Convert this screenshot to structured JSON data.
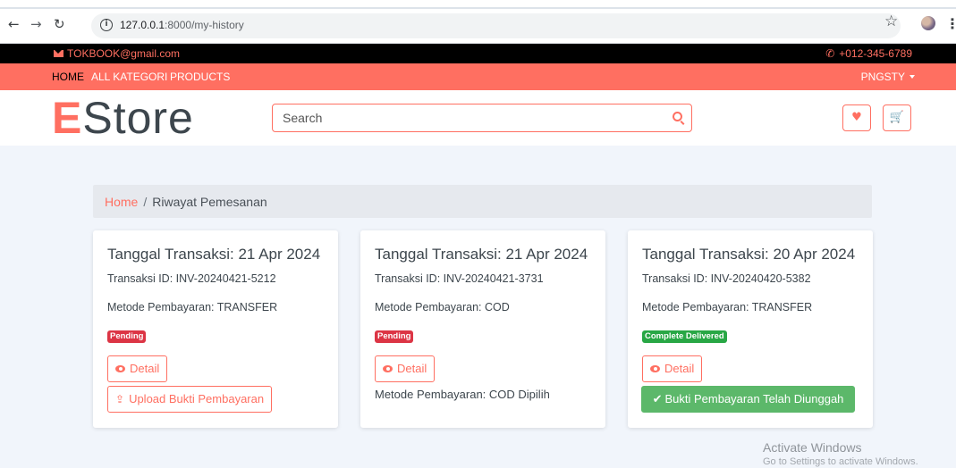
{
  "browser": {
    "back_icon": "arrow-left-icon",
    "forward_icon": "arrow-right-icon",
    "reload_icon": "reload-icon",
    "url_host": "127.0.0.1",
    "url_path": ":8000/my-history"
  },
  "topbar": {
    "email": "TOKBOOK@gmail.com",
    "phone": "+012-345-6789"
  },
  "nav": {
    "items": [
      {
        "label": "HOME",
        "active": true
      },
      {
        "label": "ALL KATEGORI",
        "active": false
      },
      {
        "label": "PRODUCTS",
        "active": false
      }
    ],
    "user": "PNGSTY"
  },
  "header": {
    "logo_first": "E",
    "logo_rest": "Store",
    "search_placeholder": "Search"
  },
  "breadcrumb": {
    "home": "Home",
    "separator": "/",
    "current": "Riwayat Pemesanan"
  },
  "orders": [
    {
      "title": "Tanggal Transaksi: 21 Apr 2024",
      "transaction_id": "Transaksi ID: INV-20240421-5212",
      "payment_method": "Metode Pembayaran: TRANSFER",
      "status": "Pending",
      "detail_label": "Detail",
      "action_label": "Upload Bukti Pembayaran"
    },
    {
      "title": "Tanggal Transaksi: 21 Apr 2024",
      "transaction_id": "Transaksi ID: INV-20240421-3731",
      "payment_method": "Metode Pembayaran: COD",
      "status": "Pending",
      "detail_label": "Detail",
      "note": "Metode Pembayaran: COD Dipilih"
    },
    {
      "title": "Tanggal Transaksi: 20 Apr 2024",
      "transaction_id": "Transaksi ID: INV-20240420-5382",
      "payment_method": "Metode Pembayaran: TRANSFER",
      "status": "Complete Delivered",
      "detail_label": "Detail",
      "success_label": "Bukti Pembayaran Telah Diunggah"
    }
  ],
  "watermark": {
    "title": "Activate Windows",
    "subtitle": "Go to Settings to activate Windows."
  },
  "colors": {
    "accent": "#ff6f61",
    "dark": "#3d464d",
    "success": "#5cb86a",
    "danger": "#dc3545"
  }
}
